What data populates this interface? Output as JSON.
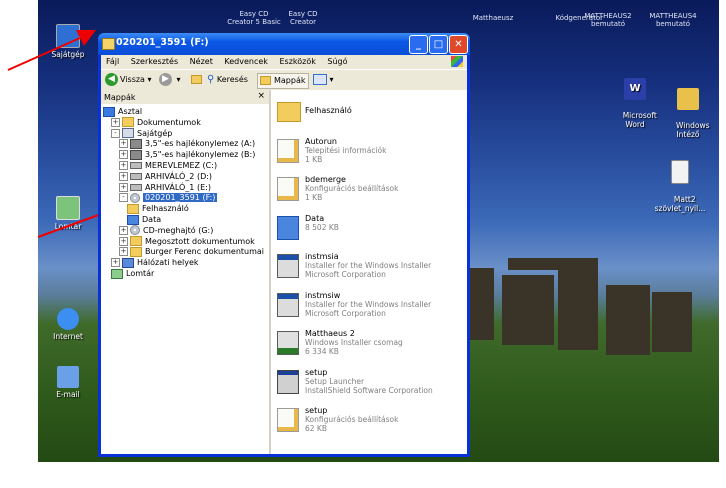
{
  "desktop": {
    "top_labels": [
      {
        "text": "Easy CD\nCreator 5 Basic"
      },
      {
        "text": "Easy CD\nCreator"
      },
      {
        "text": "Matthaeusz"
      },
      {
        "text": "Kódgenerátor"
      },
      {
        "text": "MATTHEAUS2\nbemutató"
      },
      {
        "text": "MATTHEAUS4\nbemutató"
      }
    ],
    "icons": {
      "my_computer": "Sajátgép",
      "recycle": "Lomtár",
      "internet": "Internet",
      "email": "E-mail",
      "word": "Microsoft\nWord",
      "windows_intezo": "Windows\nIntéző",
      "matt2": "Matt2\nszövlet_nyil..."
    }
  },
  "window": {
    "title": "020201_3591 (F:)",
    "menu": [
      "Fájl",
      "Szerkesztés",
      "Nézet",
      "Kedvencek",
      "Eszközök",
      "Súgó"
    ],
    "toolbar": {
      "back": "Vissza",
      "search": "Keresés",
      "folders": "Mappák"
    },
    "folders_title": "Mappák",
    "tree": [
      {
        "label": "Asztal",
        "indent": 0,
        "pm": "",
        "icon": "desktop"
      },
      {
        "label": "Dokumentumok",
        "indent": 1,
        "pm": "+",
        "icon": "folder"
      },
      {
        "label": "Sajátgép",
        "indent": 1,
        "pm": "-",
        "icon": "computer"
      },
      {
        "label": "3,5\"-es hajlékonylemez (A:)",
        "indent": 2,
        "pm": "+",
        "icon": "floppy"
      },
      {
        "label": "3,5\"-es hajlékonylemez (B:)",
        "indent": 2,
        "pm": "+",
        "icon": "floppy"
      },
      {
        "label": "MEREVLEMEZ (C:)",
        "indent": 2,
        "pm": "+",
        "icon": "drive"
      },
      {
        "label": "ARHIVÁLÓ_2 (D:)",
        "indent": 2,
        "pm": "+",
        "icon": "drive"
      },
      {
        "label": "ARHIVÁLÓ_1 (E:)",
        "indent": 2,
        "pm": "+",
        "icon": "drive"
      },
      {
        "label": "020201_3591 (F:)",
        "indent": 2,
        "pm": "-",
        "icon": "cd",
        "selected": true
      },
      {
        "label": "Felhasználó",
        "indent": 3,
        "pm": "",
        "icon": "folder"
      },
      {
        "label": "Data",
        "indent": 3,
        "pm": "",
        "icon": "data"
      },
      {
        "label": "CD-meghajtó (G:)",
        "indent": 2,
        "pm": "+",
        "icon": "cd"
      },
      {
        "label": "Megosztott dokumentumok",
        "indent": 2,
        "pm": "+",
        "icon": "folder"
      },
      {
        "label": "Burger Ferenc dokumentumai",
        "indent": 2,
        "pm": "+",
        "icon": "folder"
      },
      {
        "label": "Hálózati helyek",
        "indent": 1,
        "pm": "+",
        "icon": "network"
      },
      {
        "label": "Lomtár",
        "indent": 1,
        "pm": "",
        "icon": "recycle"
      }
    ],
    "files": [
      {
        "name": "Felhasználó",
        "line1": "",
        "line2": "",
        "icon": "folder"
      },
      {
        "name": "Autorun",
        "line1": "Telepítési információk",
        "line2": "1 KB",
        "icon": "inf"
      },
      {
        "name": "bdemerge",
        "line1": "Konfigurációs beállítások",
        "line2": "1 KB",
        "icon": "inf"
      },
      {
        "name": "Data",
        "line1": "8 502 KB",
        "line2": "",
        "icon": "data"
      },
      {
        "name": "instmsia",
        "line1": "Installer for the Windows Installer",
        "line2": "Microsoft Corporation",
        "icon": "exe"
      },
      {
        "name": "instmsiw",
        "line1": "Installer for the Windows Installer",
        "line2": "Microsoft Corporation",
        "icon": "exe"
      },
      {
        "name": "Matthaeus 2",
        "line1": "Windows Installer csomag",
        "line2": "6 334 KB",
        "icon": "msi"
      },
      {
        "name": "setup",
        "line1": "Setup Launcher",
        "line2": "InstallShield Software Corporation",
        "icon": "setup"
      },
      {
        "name": "setup",
        "line1": "Konfigurációs beállítások",
        "line2": "62 KB",
        "icon": "inf"
      }
    ]
  }
}
